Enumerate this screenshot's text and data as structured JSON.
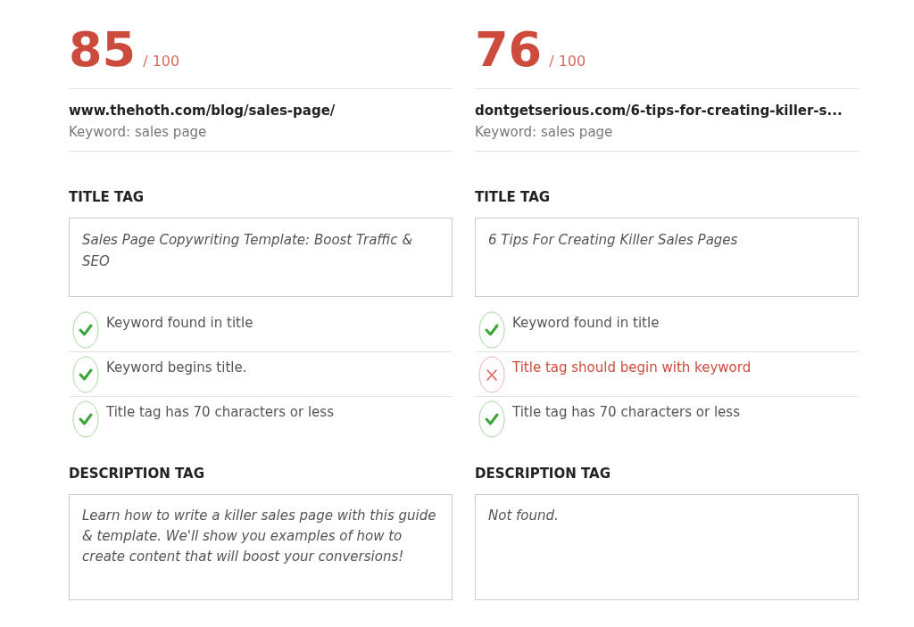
{
  "reports": [
    {
      "score": "85",
      "max": "/ 100",
      "url": "www.thehoth.com/blog/sales-page/",
      "keyword": "Keyword: sales page",
      "title_heading": "TITLE TAG",
      "title_value": "Sales Page Copywriting Template: Boost Traffic & SEO",
      "checks": [
        {
          "text": "Keyword found in title",
          "passed": true
        },
        {
          "text": "Keyword begins title.",
          "passed": true
        },
        {
          "text": "Title tag has 70 characters or less",
          "passed": true
        }
      ],
      "description_heading": "DESCRIPTION TAG",
      "description_value": "Learn how to write a killer sales page with this guide & template. We'll show you examples of how to create content that will boost your conversions!"
    },
    {
      "score": "76",
      "max": "/ 100",
      "url": "dontgetserious.com/6-tips-for-creating-killer-s...",
      "keyword": "Keyword: sales page",
      "title_heading": "TITLE TAG",
      "title_value": "6 Tips For Creating Killer Sales Pages",
      "checks": [
        {
          "text": "Keyword found in title",
          "passed": true
        },
        {
          "text": "Title tag should begin with keyword",
          "passed": false
        },
        {
          "text": "Title tag has 70 characters or less",
          "passed": true
        }
      ],
      "description_heading": "DESCRIPTION TAG",
      "description_value": "Not found."
    }
  ]
}
